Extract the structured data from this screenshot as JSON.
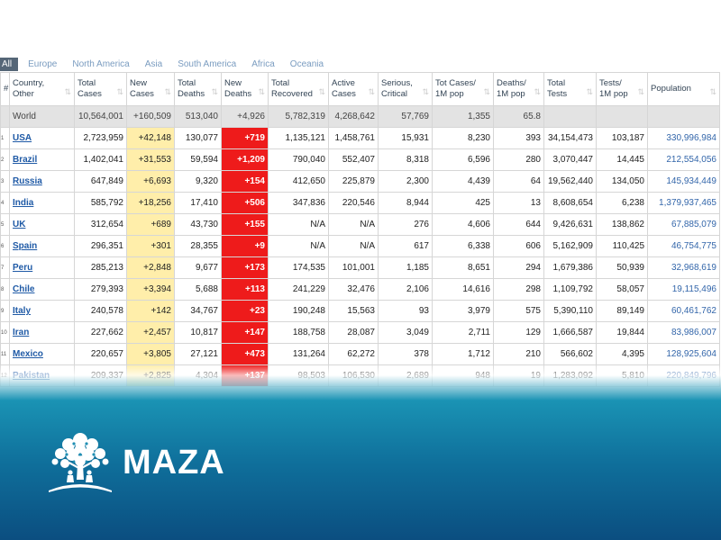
{
  "tabs": [
    {
      "label": "All",
      "active": true
    },
    {
      "label": "Europe",
      "active": false
    },
    {
      "label": "North America",
      "active": false
    },
    {
      "label": "Asia",
      "active": false
    },
    {
      "label": "South America",
      "active": false
    },
    {
      "label": "Africa",
      "active": false
    },
    {
      "label": "Oceania",
      "active": false
    }
  ],
  "columns": [
    {
      "line1": "#",
      "line2": ""
    },
    {
      "line1": "Country,",
      "line2": "Other"
    },
    {
      "line1": "Total",
      "line2": "Cases"
    },
    {
      "line1": "New",
      "line2": "Cases"
    },
    {
      "line1": "Total",
      "line2": "Deaths"
    },
    {
      "line1": "New",
      "line2": "Deaths"
    },
    {
      "line1": "Total",
      "line2": "Recovered"
    },
    {
      "line1": "Active",
      "line2": "Cases"
    },
    {
      "line1": "Serious,",
      "line2": "Critical"
    },
    {
      "line1": "Tot Cases/",
      "line2": "1M pop"
    },
    {
      "line1": "Deaths/",
      "line2": "1M pop"
    },
    {
      "line1": "Total",
      "line2": "Tests"
    },
    {
      "line1": "Tests/",
      "line2": "1M pop"
    },
    {
      "line1": "",
      "line2": "Population"
    }
  ],
  "world_row": [
    "",
    "World",
    "10,564,001",
    "+160,509",
    "513,040",
    "+4,926",
    "5,782,319",
    "4,268,642",
    "57,769",
    "1,355",
    "65.8",
    "",
    "",
    ""
  ],
  "rows": [
    [
      "1",
      "USA",
      "2,723,959",
      "+42,148",
      "130,077",
      "+719",
      "1,135,121",
      "1,458,761",
      "15,931",
      "8,230",
      "393",
      "34,154,473",
      "103,187",
      "330,996,984"
    ],
    [
      "2",
      "Brazil",
      "1,402,041",
      "+31,553",
      "59,594",
      "+1,209",
      "790,040",
      "552,407",
      "8,318",
      "6,596",
      "280",
      "3,070,447",
      "14,445",
      "212,554,056"
    ],
    [
      "3",
      "Russia",
      "647,849",
      "+6,693",
      "9,320",
      "+154",
      "412,650",
      "225,879",
      "2,300",
      "4,439",
      "64",
      "19,562,440",
      "134,050",
      "145,934,449"
    ],
    [
      "4",
      "India",
      "585,792",
      "+18,256",
      "17,410",
      "+506",
      "347,836",
      "220,546",
      "8,944",
      "425",
      "13",
      "8,608,654",
      "6,238",
      "1,379,937,465"
    ],
    [
      "5",
      "UK",
      "312,654",
      "+689",
      "43,730",
      "+155",
      "N/A",
      "N/A",
      "276",
      "4,606",
      "644",
      "9,426,631",
      "138,862",
      "67,885,079"
    ],
    [
      "6",
      "Spain",
      "296,351",
      "+301",
      "28,355",
      "+9",
      "N/A",
      "N/A",
      "617",
      "6,338",
      "606",
      "5,162,909",
      "110,425",
      "46,754,775"
    ],
    [
      "7",
      "Peru",
      "285,213",
      "+2,848",
      "9,677",
      "+173",
      "174,535",
      "101,001",
      "1,185",
      "8,651",
      "294",
      "1,679,386",
      "50,939",
      "32,968,619"
    ],
    [
      "8",
      "Chile",
      "279,393",
      "+3,394",
      "5,688",
      "+113",
      "241,229",
      "32,476",
      "2,106",
      "14,616",
      "298",
      "1,109,792",
      "58,057",
      "19,115,496"
    ],
    [
      "9",
      "Italy",
      "240,578",
      "+142",
      "34,767",
      "+23",
      "190,248",
      "15,563",
      "93",
      "3,979",
      "575",
      "5,390,110",
      "89,149",
      "60,461,762"
    ],
    [
      "10",
      "Iran",
      "227,662",
      "+2,457",
      "10,817",
      "+147",
      "188,758",
      "28,087",
      "3,049",
      "2,711",
      "129",
      "1,666,587",
      "19,844",
      "83,986,007"
    ],
    [
      "11",
      "Mexico",
      "220,657",
      "+3,805",
      "27,121",
      "+473",
      "131,264",
      "62,272",
      "378",
      "1,712",
      "210",
      "566,602",
      "4,395",
      "128,925,604"
    ],
    [
      "12",
      "Pakistan",
      "209,337",
      "+2,825",
      "4,304",
      "+137",
      "98,503",
      "106,530",
      "2,689",
      "948",
      "19",
      "1,283,092",
      "5,810",
      "220,849,796"
    ]
  ],
  "sort_glyph": "⇅",
  "brand": {
    "name": "MAZA"
  },
  "colors": {
    "new_cases_bg": "#ffeeaa",
    "new_deaths_bg": "#ee1b1b",
    "world_row_bg": "#e3e3e3",
    "banner_dark": "#0b4e80",
    "banner_light": "#1a93b4"
  },
  "icons": {
    "logo": "tree-logo-icon",
    "sort": "sort-arrows-icon"
  }
}
